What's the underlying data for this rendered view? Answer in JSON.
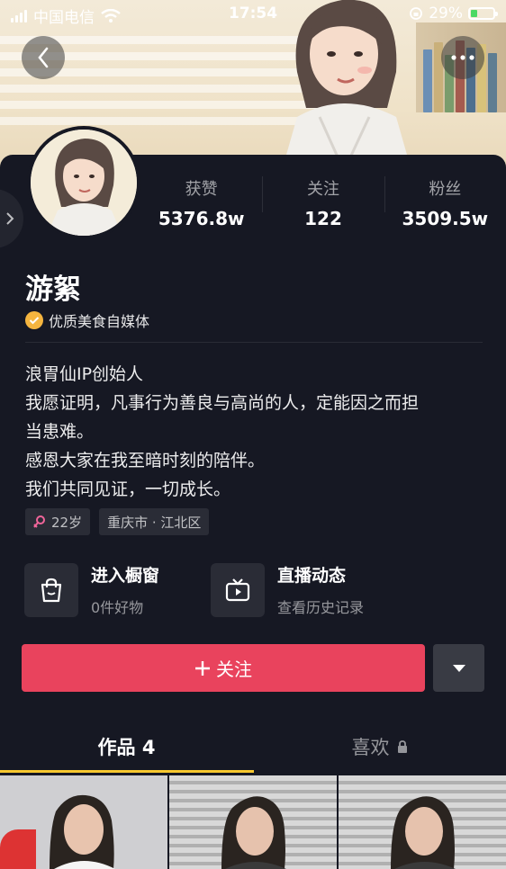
{
  "status_bar": {
    "carrier": "中国电信",
    "time": "17:54",
    "battery_text": "29%",
    "battery_level": 0.29
  },
  "header": {
    "back_icon": "chevron-left-icon",
    "more_icon": "more-horizontal-icon"
  },
  "stats": [
    {
      "label": "获赞",
      "value": "5376.8w"
    },
    {
      "label": "关注",
      "value": "122"
    },
    {
      "label": "粉丝",
      "value": "3509.5w"
    }
  ],
  "profile": {
    "name": "游絮",
    "verification": "优质美食自媒体",
    "bio": [
      "浪胃仙IP创始人",
      "我愿证明，凡事行为善良与高尚的人，定能因之而担",
      "当患难。",
      "感恩大家在我至暗时刻的陪伴。",
      "我们共同见证，一切成长。"
    ],
    "tags": [
      {
        "icon": "female-icon",
        "text": "22岁"
      },
      {
        "icon": "",
        "text": "重庆市 · 江北区"
      }
    ]
  },
  "quick_links": [
    {
      "icon": "shopping-bag-icon",
      "title": "进入橱窗",
      "subtitle": "0件好物"
    },
    {
      "icon": "live-tv-icon",
      "title": "直播动态",
      "subtitle": "查看历史记录"
    }
  ],
  "actions": {
    "follow_label": "关注",
    "dropdown_icon": "caret-down-icon"
  },
  "tabs": [
    {
      "label": "作品 4",
      "active": true
    },
    {
      "label": "喜欢",
      "active": false,
      "locked": true
    }
  ],
  "colors": {
    "background": "#161823",
    "follow_button": "#e9435d",
    "tab_underline": "#f7c830",
    "verify_badge": "#f5b53f"
  }
}
